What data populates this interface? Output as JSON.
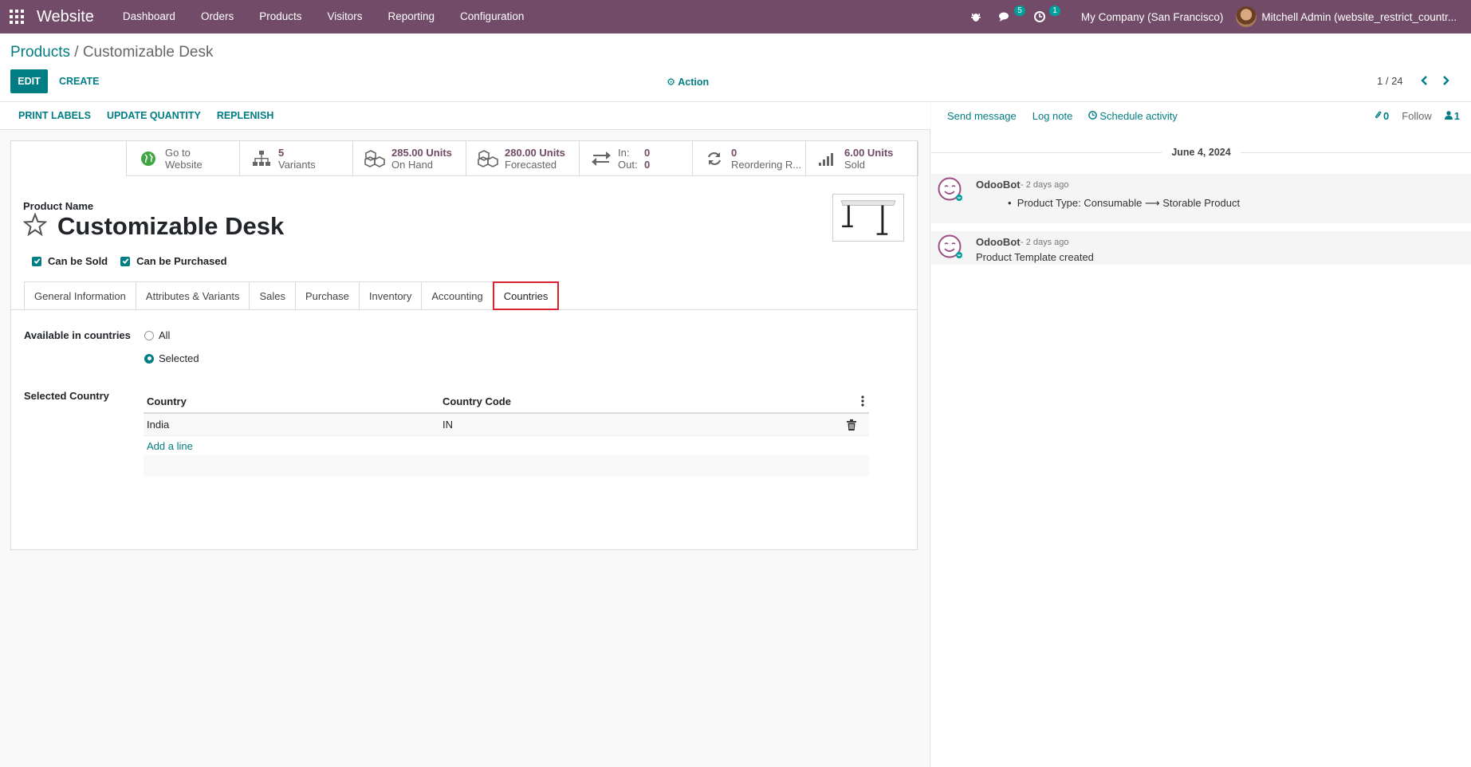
{
  "topbar": {
    "app_name": "Website",
    "menu": [
      "Dashboard",
      "Orders",
      "Products",
      "Visitors",
      "Reporting",
      "Configuration"
    ],
    "messages_count": "5",
    "activities_count": "1",
    "company": "My Company (San Francisco)",
    "user": "Mitchell Admin (website_restrict_countr..."
  },
  "control": {
    "breadcrumb_parent": "Products",
    "breadcrumb_sep": " / ",
    "breadcrumb_current": "Customizable Desk",
    "edit_label": "EDIT",
    "create_label": "CREATE",
    "action_label": "Action",
    "pager": "1 / 24"
  },
  "statusbar": {
    "buttons": [
      "PRINT LABELS",
      "UPDATE QUANTITY",
      "REPLENISH"
    ]
  },
  "smart_buttons": {
    "website": {
      "line1": "Go to",
      "line2": "Website"
    },
    "variants": {
      "value": "5",
      "label": "Variants"
    },
    "on_hand": {
      "value": "285.00 Units",
      "label": "On Hand"
    },
    "forecasted": {
      "value": "280.00 Units",
      "label": "Forecasted"
    },
    "in_out": {
      "in_label": "In:",
      "in_value": "0",
      "out_label": "Out:",
      "out_value": "0"
    },
    "reordering": {
      "value": "0",
      "label": "Reordering R..."
    },
    "sold": {
      "value": "6.00 Units",
      "label": "Sold"
    }
  },
  "product": {
    "name_label": "Product Name",
    "name": "Customizable Desk",
    "can_be_sold": "Can be Sold",
    "can_be_purchased": "Can be Purchased"
  },
  "tabs": [
    "General Information",
    "Attributes & Variants",
    "Sales",
    "Purchase",
    "Inventory",
    "Accounting",
    "Countries"
  ],
  "countries": {
    "available_label": "Available in countries",
    "option_all": "All",
    "option_selected": "Selected",
    "selected_country_label": "Selected Country",
    "col_country": "Country",
    "col_code": "Country Code",
    "rows": [
      {
        "country": "India",
        "code": "IN"
      }
    ],
    "add_line": "Add a line"
  },
  "chatter": {
    "send_message": "Send message",
    "log_note": "Log note",
    "schedule_activity": "Schedule activity",
    "attachments": "0",
    "follow": "Follow",
    "followers": "1",
    "date": "June 4, 2024",
    "messages": [
      {
        "author": "OdooBot",
        "time": "- 2 days ago",
        "body_prefix": "Product Type: Consumable",
        "body_suffix": "Storable Product"
      },
      {
        "author": "OdooBot",
        "time": "- 2 days ago",
        "body": "Product Template created"
      }
    ]
  },
  "colors": {
    "brand": "#714b67",
    "accent": "#017e84",
    "highlight": "#d9232e"
  }
}
